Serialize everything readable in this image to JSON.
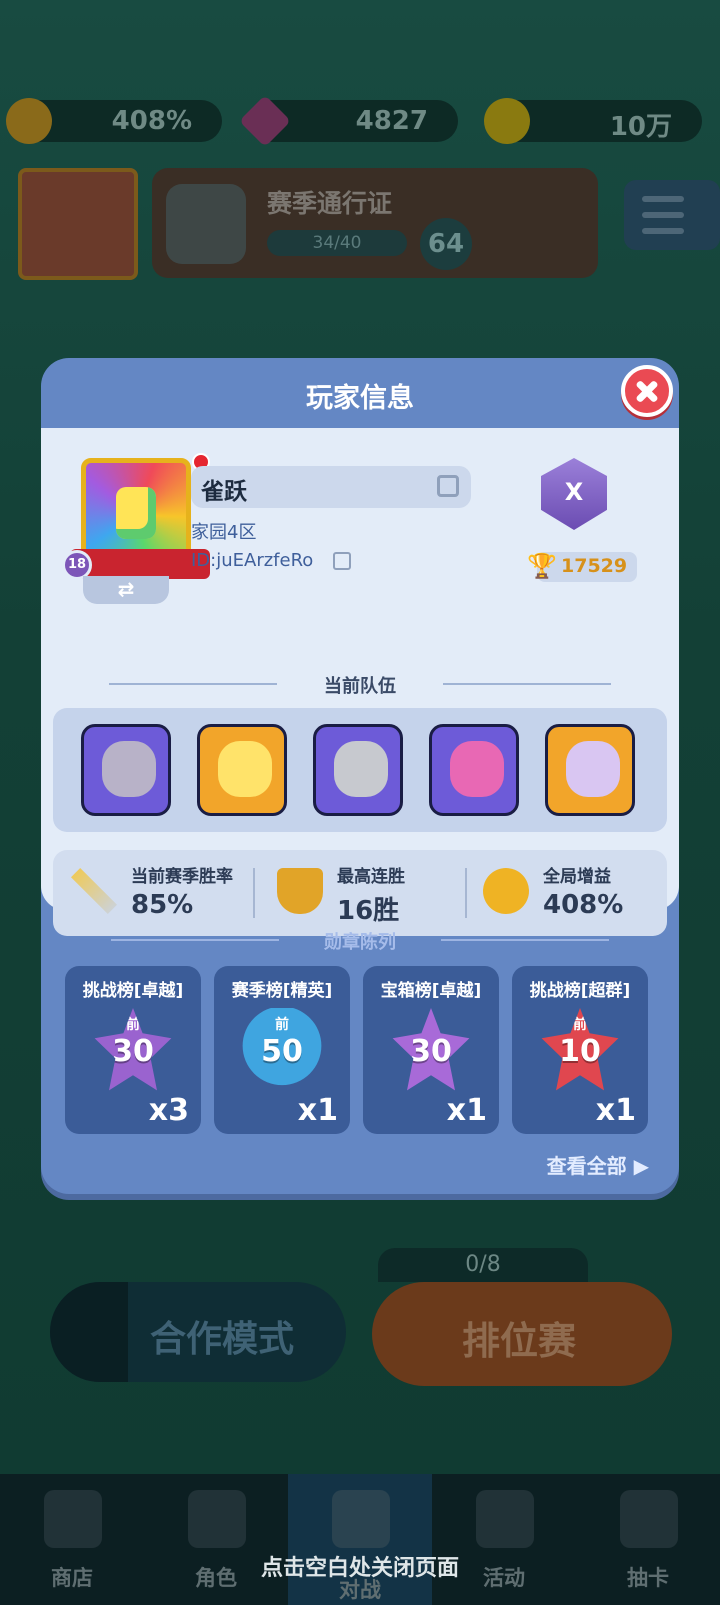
{
  "background": {
    "currency": {
      "bonus": "408%",
      "gems": "4827",
      "coins": "10万"
    },
    "avatar_level": "18",
    "season_pass": {
      "title": "赛季通行证",
      "progress": "34/40",
      "level": "64"
    },
    "modes": {
      "coop": "合作模式",
      "ranked": "排位赛",
      "ranked_count": "0/8"
    },
    "tabs": [
      {
        "label": "商店"
      },
      {
        "label": "角色"
      },
      {
        "label": "对战"
      },
      {
        "label": "活动"
      },
      {
        "label": "抽卡"
      }
    ]
  },
  "hint": "点击空白处关闭页面",
  "modal": {
    "title": "玩家信息",
    "player": {
      "name": "雀跃",
      "server": "家园4区",
      "id": "ID:juEArzfeRo",
      "level": "18",
      "rank_tier": "X",
      "trophies": "17529"
    },
    "team_title": "当前队伍",
    "team": [
      {
        "name": "hero-knight",
        "color": "#6d5bd8"
      },
      {
        "name": "hero-golden",
        "color": "#f2a52a"
      },
      {
        "name": "hero-helmet",
        "color": "#6d5bd8"
      },
      {
        "name": "hero-pink-brute",
        "color": "#6d5bd8"
      },
      {
        "name": "hero-demon",
        "color": "#f2a52a"
      }
    ],
    "stats": {
      "winrate_label": "当前赛季胜率",
      "winrate": "85%",
      "streak_label": "最高连胜",
      "streak": "16胜",
      "bonus_label": "全局增益",
      "bonus": "408%"
    },
    "medals_title": "勋章陈列",
    "medals": [
      {
        "title": "挑战榜[卓越]",
        "prefix": "前",
        "num": "30",
        "count": "x3",
        "color": "#9a63cf"
      },
      {
        "title": "赛季榜[精英]",
        "prefix": "前",
        "num": "50",
        "count": "x1",
        "color": "#3fa5e0"
      },
      {
        "title": "宝箱榜[卓越]",
        "prefix": "",
        "num": "30",
        "count": "x1",
        "color": "#a86ad8"
      },
      {
        "title": "挑战榜[超群]",
        "prefix": "前",
        "num": "10",
        "count": "x1",
        "color": "#e0474f"
      }
    ],
    "view_all": "查看全部 ▶"
  }
}
